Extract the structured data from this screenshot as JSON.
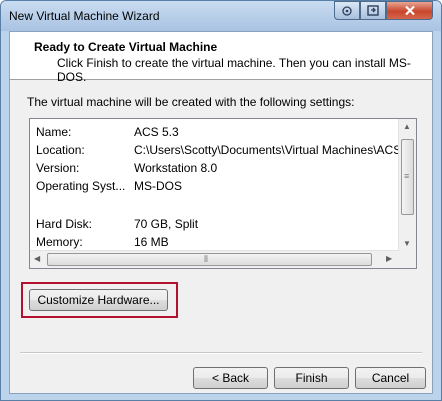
{
  "window": {
    "title": "New Virtual Machine Wizard"
  },
  "header": {
    "title": "Ready to Create Virtual Machine",
    "subtitle": "Click Finish to create the virtual machine. Then you can install MS-DOS."
  },
  "intro": "The virtual machine will be created with the following settings:",
  "settings": [
    {
      "key": "Name:",
      "value": "ACS 5.3"
    },
    {
      "key": "Location:",
      "value": "C:\\Users\\Scotty\\Documents\\Virtual Machines\\ACS ..."
    },
    {
      "key": "Version:",
      "value": "Workstation 8.0"
    },
    {
      "key": "Operating Syst...",
      "value": "MS-DOS"
    },
    {
      "key": "Hard Disk:",
      "value": "70 GB, Split"
    },
    {
      "key": "Memory:",
      "value": "16 MB"
    }
  ],
  "buttons": {
    "customize": "Customize Hardware...",
    "back": "< Back",
    "finish": "Finish",
    "cancel": "Cancel"
  },
  "colors": {
    "highlight_box": "#b3112d",
    "titlebar": "#bcd3ec"
  }
}
